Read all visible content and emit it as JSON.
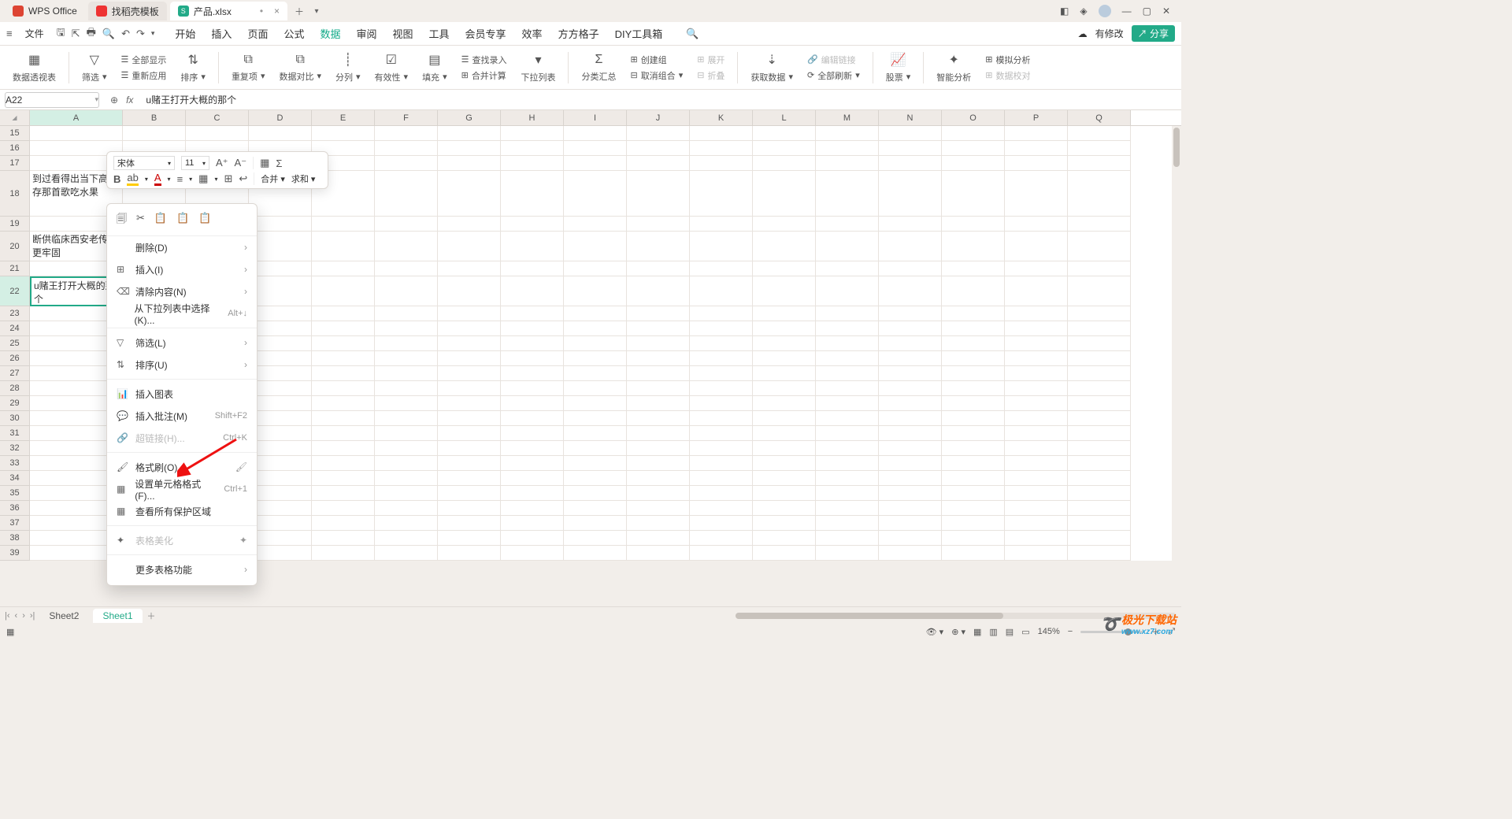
{
  "titlebar": {
    "app_name": "WPS Office",
    "tab_docer": "找稻壳模板",
    "tab_file": "产品.xlsx"
  },
  "quick": {
    "menu": "≡",
    "file": "文件"
  },
  "menutabs": [
    "开始",
    "插入",
    "页面",
    "公式",
    "数据",
    "审阅",
    "视图",
    "工具",
    "会员专享",
    "效率",
    "方方格子",
    "DIY工具箱"
  ],
  "menutabs_active_index": 4,
  "topright": {
    "modify": "有修改",
    "share": "分享"
  },
  "ribbon": {
    "pivot": "数据透视表",
    "filter": "筛选",
    "showall": "全部显示",
    "reapply": "重新应用",
    "sort": "排序",
    "dup": "重复项",
    "compare": "数据对比",
    "split": "分列",
    "valid": "有效性",
    "fill": "填充",
    "lookup": "查找录入",
    "merge": "合并计算",
    "dropdown": "下拉列表",
    "subtotal": "分类汇总",
    "group": "创建组",
    "ungroup": "取消组合",
    "expand": "展开",
    "collapse": "折叠",
    "getdata": "获取数据",
    "editlink": "编辑链接",
    "refresh": "全部刷新",
    "stock": "股票",
    "smart": "智能分析",
    "sim": "模拟分析",
    "datacheck": "数据校对"
  },
  "formula": {
    "cellref": "A22",
    "content": "u赌王打开大概的那个"
  },
  "columns": [
    "A",
    "B",
    "C",
    "D",
    "E",
    "F",
    "G",
    "H",
    "I",
    "J",
    "K",
    "L",
    "M",
    "N",
    "O",
    "P",
    "Q"
  ],
  "visible_row_start": 15,
  "visible_rows": [
    15,
    16,
    17,
    18,
    19,
    20,
    21,
    22,
    23,
    24,
    25,
    26,
    27,
    28,
    29,
    30,
    31,
    32,
    33,
    34,
    35,
    36,
    37,
    38,
    39
  ],
  "cells": {
    "r18": "到过看得出当下高库存那首歌吃水果",
    "r20": "断供临床西安老传说更牢固",
    "r22": "u赌王打开大概的那个"
  },
  "minitb": {
    "font": "宋体",
    "size": "11",
    "merge": "合并",
    "sum": "求和"
  },
  "ctx": {
    "delete": "删除(D)",
    "insert": "插入(I)",
    "clear": "清除内容(N)",
    "picklist": "从下拉列表中选择(K)...",
    "picklist_hint": "Alt+↓",
    "filter": "筛选(L)",
    "sort": "排序(U)",
    "chart": "插入图表",
    "comment": "插入批注(M)",
    "comment_hint": "Shift+F2",
    "hyperlink": "超链接(H)...",
    "hyperlink_hint": "Ctrl+K",
    "painter": "格式刷(O)",
    "cellfmt": "设置单元格格式(F)...",
    "cellfmt_hint": "Ctrl+1",
    "protect": "查看所有保护区域",
    "beautify": "表格美化",
    "more": "更多表格功能"
  },
  "sheets": {
    "s2": "Sheet2",
    "s1": "Sheet1"
  },
  "status": {
    "zoom": "145%"
  },
  "watermark": {
    "name": "极光下载站",
    "url": "www.xz7.com"
  }
}
